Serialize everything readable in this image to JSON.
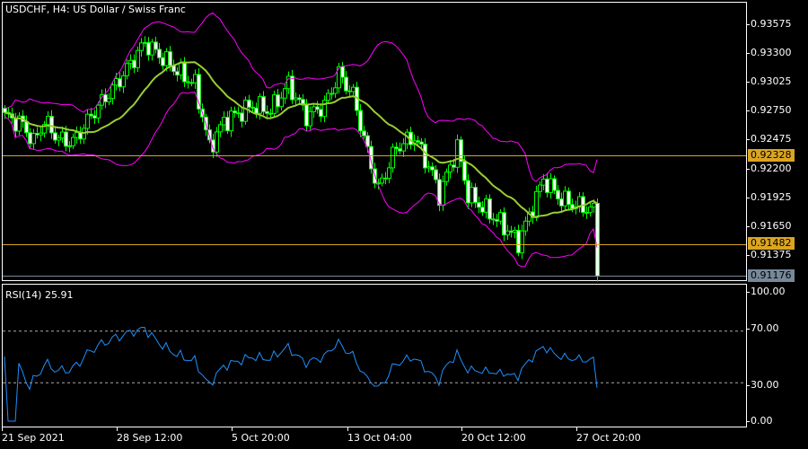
{
  "header": {
    "title": "USDCHF, H4:  US Dollar / Swiss Franc"
  },
  "rsi_panel": {
    "label": "RSI(14) 25.91",
    "levels": [
      70,
      30
    ],
    "axis_labels": [
      "100.00",
      "70.00",
      "30.00",
      "0.00"
    ]
  },
  "price_axis": {
    "labels": [
      "0.93575",
      "0.93300",
      "0.93025",
      "0.92750",
      "0.92475",
      "0.92200",
      "0.91925",
      "0.91650",
      "0.91375"
    ]
  },
  "price_lines": [
    {
      "label": "0.92328",
      "price": 0.92328,
      "color": "#daa520"
    },
    {
      "label": "0.91482",
      "price": 0.91482,
      "color": "#daa520"
    },
    {
      "label": "0.91176",
      "price": 0.91176,
      "color": "#778899"
    }
  ],
  "time_axis": {
    "labels": [
      "21 Sep 2021",
      "28 Sep 12:00",
      "5 Oct 20:00",
      "13 Oct 04:00",
      "20 Oct 12:00",
      "27 Oct 20:00"
    ]
  },
  "colors": {
    "candle": "#00ff00",
    "bands": "#ff00ff",
    "ma": "#9acd32",
    "rsi": "#1e90ff",
    "background": "#000000"
  },
  "chart_data": {
    "type": "candlestick",
    "symbol": "USDCHF",
    "timeframe": "H4",
    "close_keypoints": [
      [
        0,
        0.927
      ],
      [
        5,
        0.9262
      ],
      [
        8,
        0.9245
      ],
      [
        11,
        0.9265
      ],
      [
        15,
        0.9248
      ],
      [
        19,
        0.9245
      ],
      [
        25,
        0.9275
      ],
      [
        31,
        0.93
      ],
      [
        35,
        0.932
      ],
      [
        39,
        0.934
      ],
      [
        44,
        0.9325
      ],
      [
        49,
        0.931
      ],
      [
        53,
        0.93
      ],
      [
        56,
        0.9255
      ],
      [
        57,
        0.924
      ],
      [
        61,
        0.9265
      ],
      [
        69,
        0.928
      ],
      [
        74,
        0.9275
      ],
      [
        79,
        0.93
      ],
      [
        84,
        0.927
      ],
      [
        89,
        0.928
      ],
      [
        93,
        0.931
      ],
      [
        97,
        0.929
      ],
      [
        101,
        0.9235
      ],
      [
        104,
        0.92
      ],
      [
        109,
        0.924
      ],
      [
        114,
        0.925
      ],
      [
        119,
        0.9215
      ],
      [
        121,
        0.9195
      ],
      [
        126,
        0.924
      ],
      [
        129,
        0.9195
      ],
      [
        134,
        0.918
      ],
      [
        139,
        0.9165
      ],
      [
        143,
        0.915
      ],
      [
        146,
        0.9175
      ],
      [
        150,
        0.921
      ],
      [
        155,
        0.919
      ],
      [
        159,
        0.9185
      ],
      [
        164,
        0.918
      ],
      [
        165,
        0.91176
      ]
    ],
    "indicators": [
      "Bollinger Bands (20)",
      "MA (20)",
      "RSI (14)"
    ],
    "last_rsi": 25.91
  }
}
